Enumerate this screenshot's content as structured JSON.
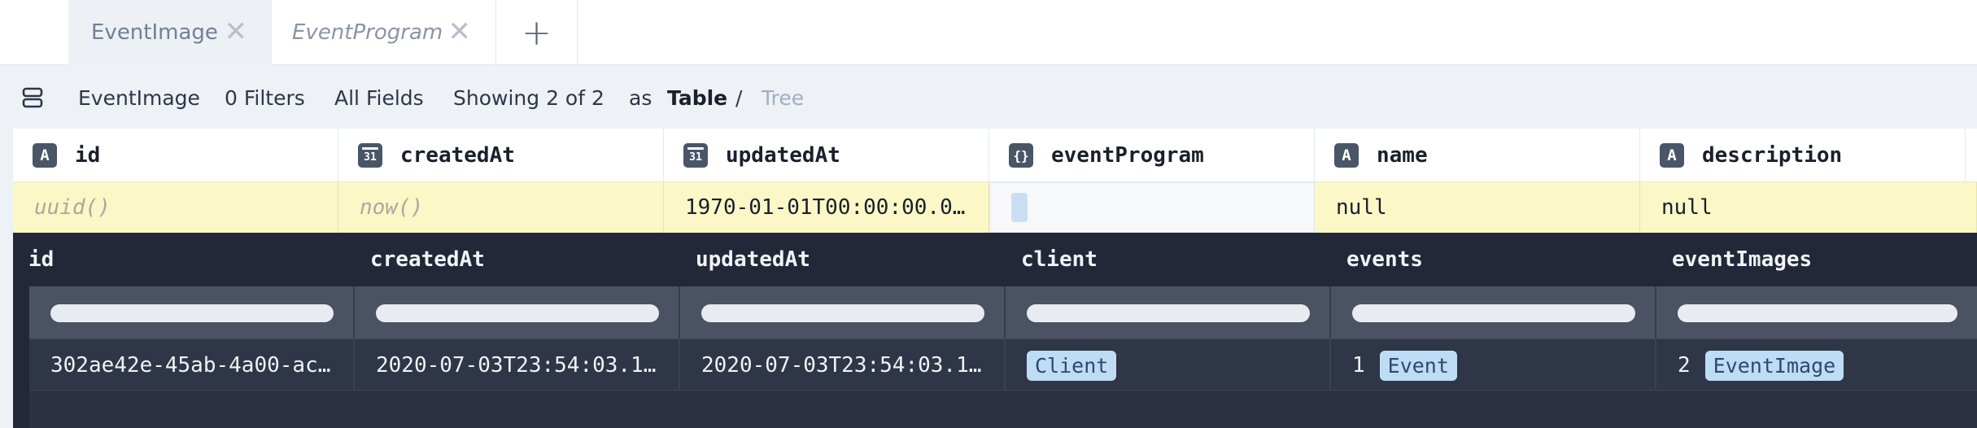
{
  "tabs": [
    {
      "label": "EventImage",
      "close_icon": "close-icon"
    },
    {
      "label": "EventProgram",
      "close_icon": "close-icon"
    }
  ],
  "add_tab_label": "+",
  "toolbar": {
    "model": "EventImage",
    "filters": "0 Filters",
    "fields": "All Fields",
    "showing": "Showing 2 of 2",
    "as_label": "as",
    "view_table": "Table",
    "view_separator": "/",
    "view_tree": "Tree"
  },
  "columns": [
    {
      "name": "id",
      "icon": "A",
      "type_icon": "text-type-icon"
    },
    {
      "name": "createdAt",
      "icon": "31",
      "type_icon": "calendar-type-icon"
    },
    {
      "name": "updatedAt",
      "icon": "31",
      "type_icon": "calendar-type-icon"
    },
    {
      "name": "eventProgram",
      "icon": "{}",
      "type_icon": "relation-type-icon"
    },
    {
      "name": "name",
      "icon": "A",
      "type_icon": "text-type-icon"
    },
    {
      "name": "description",
      "icon": "A",
      "type_icon": "text-type-icon"
    }
  ],
  "edit_row": [
    "uuid()",
    "now()",
    "1970-01-01T00:00:00.0…",
    "",
    "null",
    "null"
  ],
  "nested": {
    "columns": [
      "id",
      "createdAt",
      "updatedAt",
      "client",
      "events",
      "eventImages"
    ],
    "row": {
      "id": "302ae42e-45ab-4a00-ac…",
      "createdAt": "2020-07-03T23:54:03.1…",
      "updatedAt": "2020-07-03T23:54:03.1…",
      "client": "Client",
      "events_count": "1",
      "events": "Event",
      "eventImages_count": "2",
      "eventImages": "EventImage"
    }
  },
  "colors": {
    "accent_chip": "#bfdcf5",
    "edit_row_bg": "#fbf7c6",
    "panel_bg": "#232838"
  }
}
